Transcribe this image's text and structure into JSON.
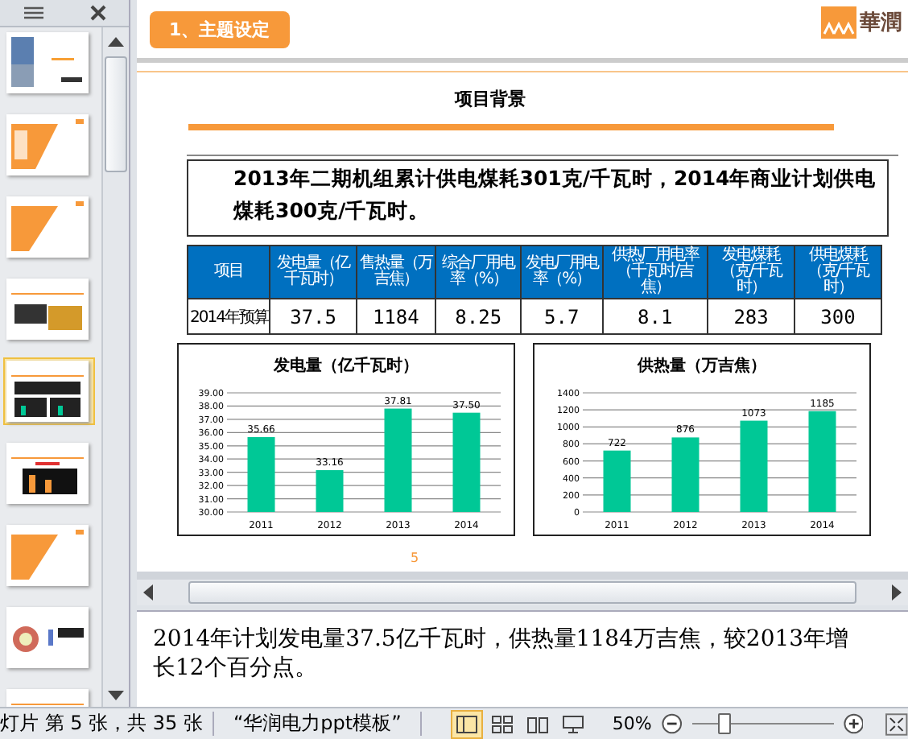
{
  "thumbnails_panel": {
    "thumbnails": [
      {
        "kind": "photo",
        "selected": false
      },
      {
        "kind": "orange-list",
        "selected": false
      },
      {
        "kind": "orange-title",
        "selected": false
      },
      {
        "kind": "diagram",
        "selected": false
      },
      {
        "kind": "table-chart",
        "selected": true
      },
      {
        "kind": "bar-chart",
        "selected": false
      },
      {
        "kind": "orange-title",
        "selected": false
      },
      {
        "kind": "target",
        "selected": false
      },
      {
        "kind": "table",
        "selected": false
      }
    ]
  },
  "slide": {
    "section_tab": "1、主题设定",
    "logo": "華潤",
    "title": "项目背景",
    "summary": "2013年二期机组累计供电煤耗301克/千瓦时，2014年商业计划供电煤耗300克/千瓦时。",
    "table": {
      "columns": [
        "项目",
        "发电量（亿千瓦时）",
        "售热量（万吉焦）",
        "综合厂用电率（%）",
        "发电厂用电率（%）",
        "供热厂用电率（千瓦时/吉焦）",
        "发电煤耗（克/千瓦时）",
        "供电煤耗（克/千瓦时）"
      ],
      "rows": [
        [
          "2014年预算",
          "37.5",
          "1184",
          "8.25",
          "5.7",
          "8.1",
          "283",
          "300"
        ]
      ]
    },
    "charts": [
      {
        "chart_data": {
          "type": "bar",
          "title": "发电量（亿千瓦时）",
          "categories": [
            "2011",
            "2012",
            "2013",
            "2014"
          ],
          "series": [
            {
              "color": "#00c896",
              "values": [
                35.66,
                33.16,
                37.81,
                37.5
              ]
            }
          ],
          "grid": true,
          "ylim": [
            30,
            39
          ],
          "yticks": [
            {
              "value": 30,
              "label": "30.00"
            },
            {
              "value": 31,
              "label": "31.00"
            },
            {
              "value": 32,
              "label": "32.00"
            },
            {
              "value": 33,
              "label": "33.00"
            },
            {
              "value": 34,
              "label": "34.00"
            },
            {
              "value": 35,
              "label": "35.00"
            },
            {
              "value": 36,
              "label": "36.00"
            },
            {
              "value": 37,
              "label": "37.00"
            },
            {
              "value": 38,
              "label": "38.00"
            },
            {
              "value": 39,
              "label": "39.00"
            }
          ],
          "value_labels": [
            "35.66",
            "33.16",
            "37.81",
            "37.50"
          ]
        }
      },
      {
        "chart_data": {
          "type": "bar",
          "title": "供热量（万吉焦）",
          "categories": [
            "2011",
            "2012",
            "2013",
            "2014"
          ],
          "series": [
            {
              "color": "#00c896",
              "values": [
                722,
                876,
                1073,
                1185
              ]
            }
          ],
          "grid": true,
          "ylim": [
            0,
            1400
          ],
          "yticks": [
            0,
            200,
            400,
            600,
            800,
            1000,
            1200,
            1400
          ],
          "value_labels": [
            "722",
            "876",
            "1073",
            "1185"
          ]
        }
      }
    ],
    "page_number": "5"
  },
  "notes": "2014年计划发电量37.5亿千瓦时，供热量1184万吉焦，较2013年增长12个百分点。",
  "status_bar": {
    "slide_info": "灯片 第 5 张，共 35 张",
    "theme": "“华润电力ppt模板”",
    "views": [
      {
        "kind": "normal",
        "selected": true
      },
      {
        "kind": "sorter",
        "selected": false
      },
      {
        "kind": "reading",
        "selected": false
      },
      {
        "kind": "slideshow",
        "selected": false
      }
    ],
    "zoom": "50%",
    "zoom_slider": {
      "level": 0.22
    }
  }
}
